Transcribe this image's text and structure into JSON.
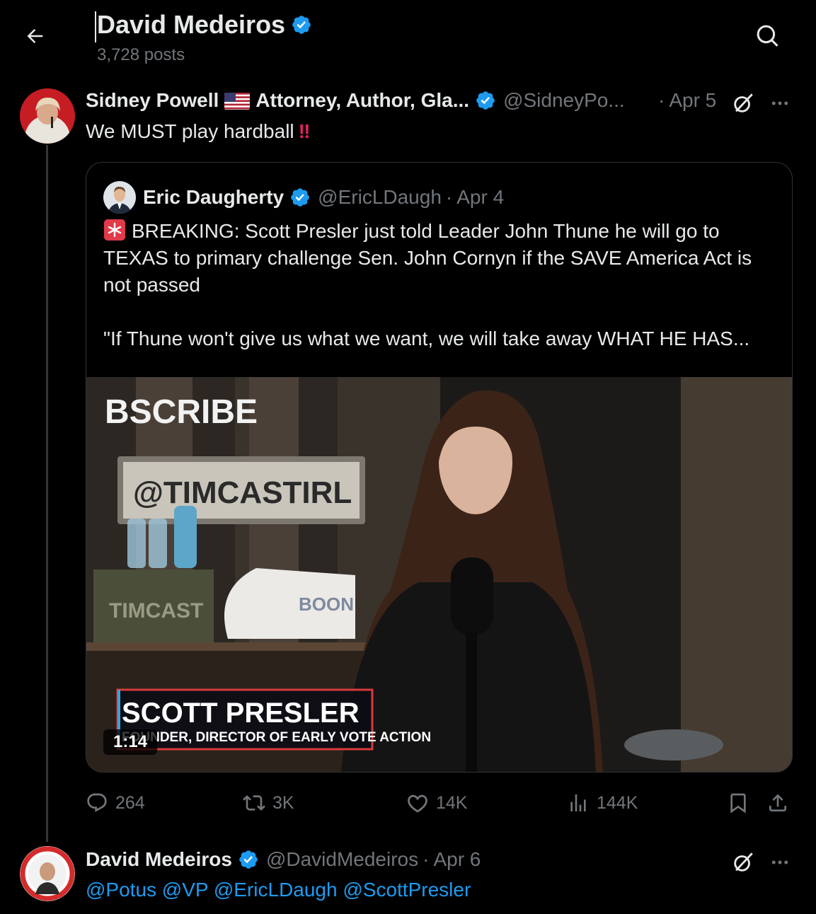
{
  "header": {
    "title": "David Medeiros",
    "posts_count": "3,728 posts"
  },
  "main_post": {
    "author_name": "Sidney Powell",
    "author_bio": "Attorney, Author, Gla...",
    "handle": "@SidneyPo...",
    "separator": "·",
    "time": "Apr 5",
    "text": "We MUST play hardball",
    "emoji": "‼",
    "stats": {
      "replies": "264",
      "reposts": "3K",
      "likes": "14K",
      "views": "144K"
    }
  },
  "quoted_post": {
    "author_name": "Eric Daugherty",
    "handle": "@EricLDaugh",
    "separator": "·",
    "time": "Apr 4",
    "paragraph_1": "BREAKING: Scott Presler just told Leader John Thune he will go to TEXAS to primary challenge Sen. John Cornyn if the SAVE America Act is not passed",
    "paragraph_2": "\"If Thune won't give us what we want, we will take away WHAT HE HAS...",
    "video": {
      "duration": "1:14",
      "subscribe_text": "BSCRIBE",
      "sign_text": "@TIMCASTIRL",
      "box_text": "TIMCAST",
      "board_text": "BOON",
      "lower_third_name": "SCOTT PRESLER",
      "lower_third_title": "FOUNDER, DIRECTOR OF EARLY VOTE ACTION"
    }
  },
  "reply_post": {
    "author_name": "David Medeiros",
    "handle": "@DavidMedeiros",
    "separator": "·",
    "time": "Apr 6",
    "mentions": "@Potus @VP @EricLDaugh @ScottPresler"
  },
  "colors": {
    "background": "#000000",
    "text": "#e7e9ea",
    "secondary": "#71767b",
    "accent": "#1d9bf0",
    "border": "#2f3336"
  }
}
